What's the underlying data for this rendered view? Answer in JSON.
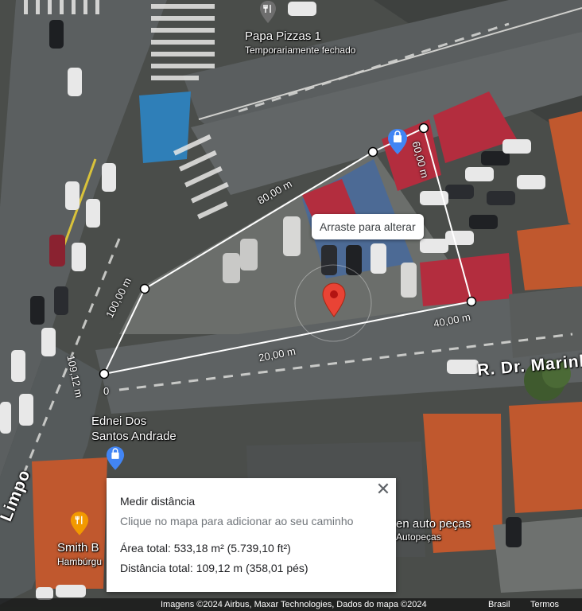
{
  "places": {
    "pizza_name": "Papa Pizzas 1",
    "pizza_status": "Temporariamente fechado",
    "ednei_line1": "Ednei Dos",
    "ednei_line2": "Santos Andrade",
    "smith_name": "Smith B",
    "smith_sub": "Hambúrgu",
    "autopecas_name": "en auto peças",
    "autopecas_sub": "Autopeças"
  },
  "streets": {
    "marinho": "R. Dr. Marinh",
    "limpo": "Limpo"
  },
  "measurement": {
    "segments": [
      "80,00 m",
      "60,00 m",
      "100,00 m",
      "40,00 m",
      "20,00 m",
      "109,12 m",
      "0"
    ],
    "tooltip": "Arraste para alterar"
  },
  "card": {
    "title": "Medir distância",
    "subtitle": "Clique no mapa para adicionar ao seu caminho",
    "area": "Área total: 533,18 m² (5.739,10 ft²)",
    "distance": "Distância total: 109,12 m (358,01 pés)",
    "close_icon": "close-icon"
  },
  "footer": {
    "attribution": "Imagens ©2024 Airbus, Maxar Technologies, Dados do mapa ©2024",
    "country": "Brasil",
    "terms": "Termos"
  },
  "colors": {
    "measure_line": "#ffffff",
    "pin_red": "#e94335",
    "shop_blue": "#4285f4",
    "road": "#55595a",
    "roof_red": "#b32d3e",
    "roof_orange": "#c0582e"
  },
  "icons": [
    "restaurant-pin-icon",
    "shopping-bag-pin-icon",
    "location-pin-icon",
    "close-icon"
  ]
}
